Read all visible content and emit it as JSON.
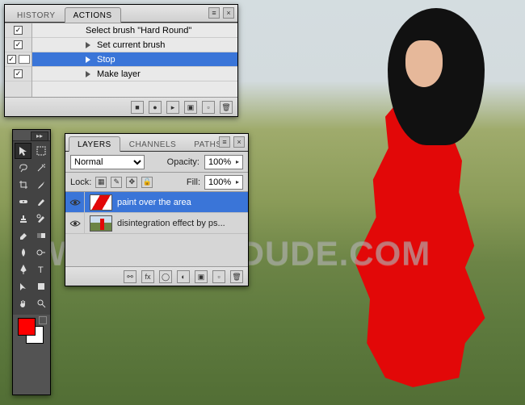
{
  "watermark": "WWW.PSD-DUDE.COM",
  "actions_panel": {
    "tabs": [
      "HISTORY",
      "ACTIONS"
    ],
    "active_tab": 1,
    "items": [
      {
        "label": "Select brush \"Hard Round\"",
        "checked": true,
        "selected": false,
        "level": 0,
        "expandable": false
      },
      {
        "label": "Set current brush",
        "checked": true,
        "selected": false,
        "level": 1,
        "expandable": true
      },
      {
        "label": "Stop",
        "checked": true,
        "selected": true,
        "level": 1,
        "expandable": true,
        "modal": true
      },
      {
        "label": "Make layer",
        "checked": true,
        "selected": false,
        "level": 1,
        "expandable": true
      }
    ]
  },
  "layers_panel": {
    "tabs": [
      "LAYERS",
      "CHANNELS",
      "PATHS"
    ],
    "active_tab": 0,
    "blend_mode": "Normal",
    "opacity_label": "Opacity:",
    "opacity_value": "100%",
    "lock_label": "Lock:",
    "fill_label": "Fill:",
    "fill_value": "100%",
    "layers": [
      {
        "name": "paint over the area",
        "visible": true,
        "selected": true,
        "thumb": "red"
      },
      {
        "name": "disintegration effect by ps...",
        "visible": true,
        "selected": false,
        "thumb": "scene"
      }
    ]
  },
  "tools_panel": {
    "foreground": "#ff0000",
    "background": "#ffffff",
    "active_tool": "move-tool"
  }
}
